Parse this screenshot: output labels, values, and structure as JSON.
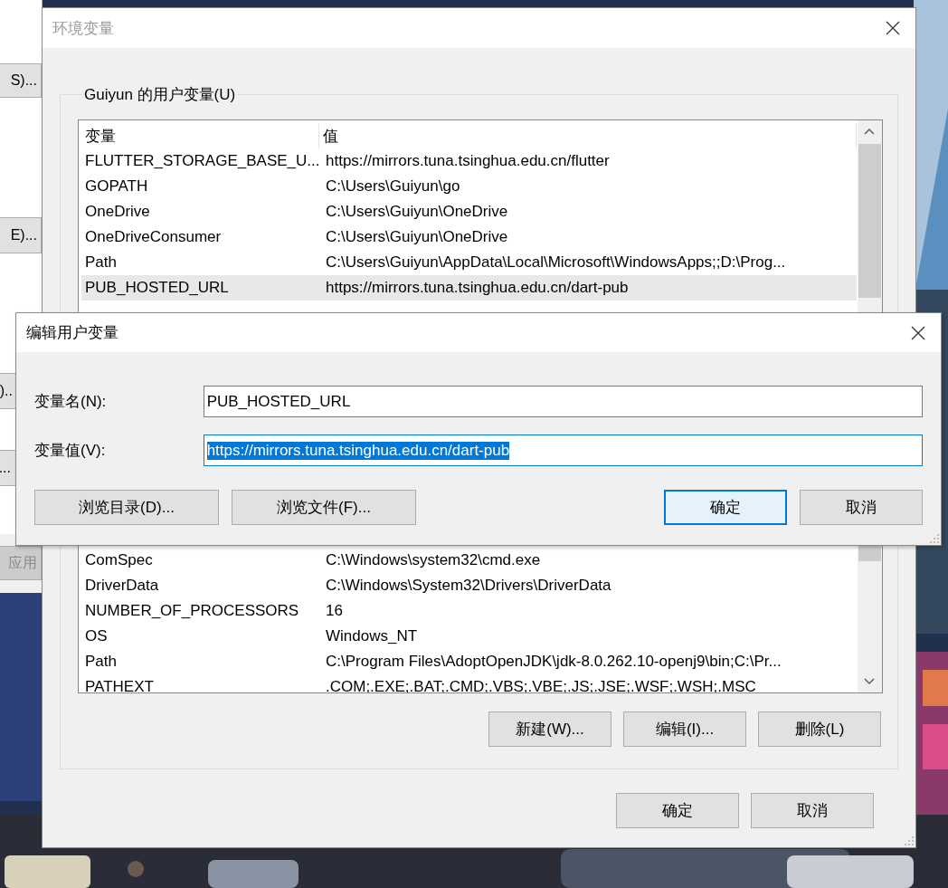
{
  "back_window": {
    "buttons": [
      {
        "label": "S)...",
        "disabled": false
      },
      {
        "label": "E)...",
        "disabled": false
      },
      {
        "label": ")..",
        "disabled": false
      },
      {
        "label": "...",
        "disabled": false
      },
      {
        "label": "应用",
        "disabled": true
      }
    ]
  },
  "env_dialog": {
    "title": "环境变量",
    "active": false,
    "user_group": {
      "label": "Guiyun 的用户变量(U)",
      "columns": [
        "变量",
        "值"
      ],
      "rows": [
        {
          "name": "FLUTTER_STORAGE_BASE_U...",
          "value": "https://mirrors.tuna.tsinghua.edu.cn/flutter",
          "selected": false
        },
        {
          "name": "GOPATH",
          "value": "C:\\Users\\Guiyun\\go",
          "selected": false
        },
        {
          "name": "OneDrive",
          "value": "C:\\Users\\Guiyun\\OneDrive",
          "selected": false
        },
        {
          "name": "OneDriveConsumer",
          "value": "C:\\Users\\Guiyun\\OneDrive",
          "selected": false
        },
        {
          "name": "Path",
          "value": "C:\\Users\\Guiyun\\AppData\\Local\\Microsoft\\WindowsApps;;D:\\Prog...",
          "selected": false
        },
        {
          "name": "PUB_HOSTED_URL",
          "value": "https://mirrors.tuna.tsinghua.edu.cn/dart-pub",
          "selected": true
        }
      ]
    },
    "system_rows": [
      {
        "name": "ComSpec",
        "value": "C:\\Windows\\system32\\cmd.exe",
        "selected": false
      },
      {
        "name": "DriverData",
        "value": "C:\\Windows\\System32\\Drivers\\DriverData",
        "selected": false
      },
      {
        "name": "NUMBER_OF_PROCESSORS",
        "value": "16",
        "selected": false
      },
      {
        "name": "OS",
        "value": "Windows_NT",
        "selected": false
      },
      {
        "name": "Path",
        "value": "C:\\Program Files\\AdoptOpenJDK\\jdk-8.0.262.10-openj9\\bin;C:\\Pr...",
        "selected": false
      },
      {
        "name": "PATHEXT",
        "value": ".COM;.EXE;.BAT;.CMD;.VBS;.VBE;.JS;.JSE;.WSF;.WSH;.MSC",
        "selected": false
      }
    ],
    "system_buttons": [
      {
        "label": "新建(W)...",
        "default": false
      },
      {
        "label": "编辑(I)...",
        "default": false
      },
      {
        "label": "删除(L)",
        "default": false
      }
    ],
    "buttons": [
      {
        "label": "确定",
        "default": false
      },
      {
        "label": "取消",
        "default": false
      }
    ]
  },
  "edit_dialog": {
    "title": "编辑用户变量",
    "active": true,
    "fields": [
      {
        "label": "变量名(N):",
        "value": "PUB_HOSTED_URL",
        "focused": false,
        "selected": false
      },
      {
        "label": "变量值(V):",
        "value": "https://mirrors.tuna.tsinghua.edu.cn/dart-pub",
        "focused": true,
        "selected": true
      }
    ],
    "left_buttons": [
      {
        "label": "浏览目录(D)...",
        "default": false
      },
      {
        "label": "浏览文件(F)...",
        "default": false
      }
    ],
    "right_buttons": [
      {
        "label": "确定",
        "default": true
      },
      {
        "label": "取消",
        "default": false
      }
    ]
  }
}
